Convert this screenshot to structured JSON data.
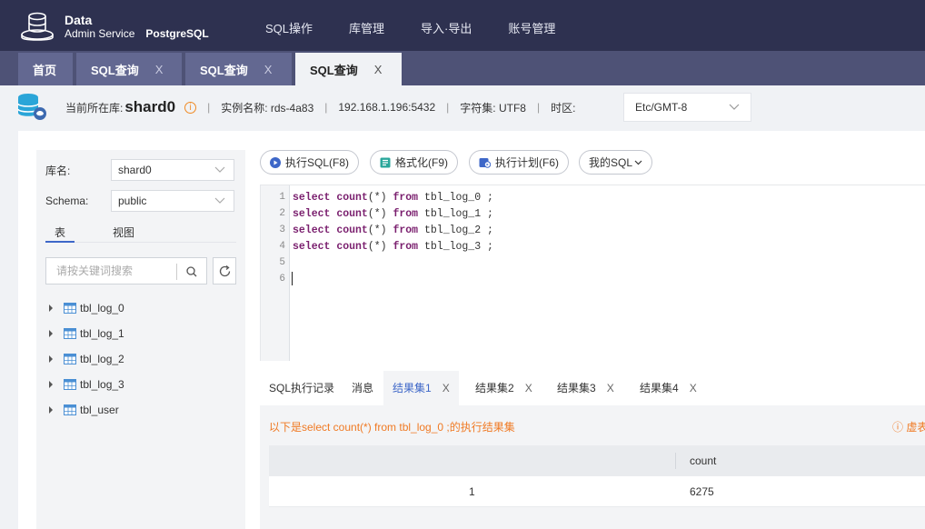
{
  "header": {
    "brand_line1": "Data",
    "brand_line2": "Admin Service",
    "brand_engine": "PostgreSQL",
    "nav": [
      "SQL操作",
      "库管理",
      "导入·导出",
      "账号管理"
    ]
  },
  "tabs": [
    {
      "label": "首页",
      "closable": false
    },
    {
      "label": "SQL查询",
      "closable": true
    },
    {
      "label": "SQL查询",
      "closable": true
    },
    {
      "label": "SQL查询",
      "closable": true,
      "active": true
    }
  ],
  "tab_close_glyph": "X",
  "info": {
    "current_db_label": "当前所在库:",
    "current_db": "shard0",
    "warn_glyph": "i",
    "separator": "|",
    "instance": "实例名称: rds-4a83",
    "host": "192.168.1.196:5432",
    "charset": "字符集: UTF8",
    "timezone_label": "时区:",
    "timezone_value": "Etc/GMT-8"
  },
  "left_panel": {
    "db_label": "库名:",
    "db_value": "shard0",
    "schema_label": "Schema:",
    "schema_value": "public",
    "tab_tables": "表",
    "tab_views": "视图",
    "search_placeholder": "请按关键词搜索",
    "tables": [
      "tbl_log_0",
      "tbl_log_1",
      "tbl_log_2",
      "tbl_log_3",
      "tbl_user"
    ]
  },
  "toolbar": {
    "run": "执行SQL(F8)",
    "format": "格式化(F9)",
    "plan": "执行计划(F6)",
    "my_sql": "我的SQL"
  },
  "editor": {
    "line_numbers": [
      "1",
      "2",
      "3",
      "4",
      "5",
      "6"
    ],
    "lines": [
      "select count(*) from tbl_log_0 ;",
      "select count(*) from tbl_log_1 ;",
      "select count(*) from tbl_log_2 ;",
      "select count(*) from tbl_log_3 ;",
      "",
      ""
    ]
  },
  "result_tabs": [
    {
      "label": "SQL执行记录",
      "closable": false
    },
    {
      "label": "消息",
      "closable": false
    },
    {
      "label": "结果集1",
      "closable": true,
      "active": true
    },
    {
      "label": "结果集2",
      "closable": true
    },
    {
      "label": "结果集3",
      "closable": true
    },
    {
      "label": "结果集4",
      "closable": true
    }
  ],
  "result": {
    "message": "以下是select count(*) from tbl_log_0 ;的执行结果集",
    "warning": "ⓘ 虚表",
    "columns": [
      "",
      "count"
    ],
    "rows": [
      [
        "1",
        "6275"
      ]
    ]
  },
  "colors": {
    "topbar": "#2e3150",
    "tabbar": "#4e5276",
    "accent_blue": "#3e67c8",
    "warn_orange": "#f07a24"
  }
}
